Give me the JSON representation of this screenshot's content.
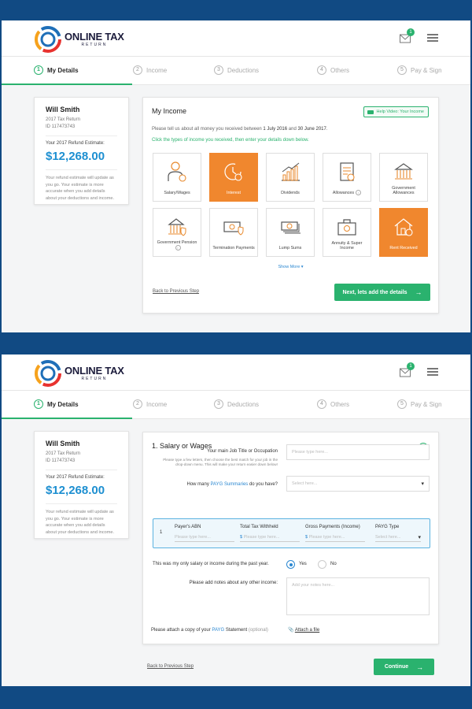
{
  "colors": {
    "accent": "#2ab26e",
    "brand_blue": "#1d8fd1",
    "selected_tile": "#f0872e",
    "background": "#114a83"
  },
  "brand": {
    "line1": "ONLINE TAX",
    "line2": "RETURN"
  },
  "header": {
    "notifications": "1",
    "icons": [
      "mail-icon",
      "menu-icon"
    ]
  },
  "steps": [
    {
      "num": "1",
      "label": "My Details"
    },
    {
      "num": "2",
      "label": "Income"
    },
    {
      "num": "3",
      "label": "Deductions"
    },
    {
      "num": "4",
      "label": "Others"
    },
    {
      "num": "5",
      "label": "Pay & Sign"
    }
  ],
  "user": {
    "name": "Will Smith",
    "return_year": "2017 Tax Return",
    "id": "ID 117473743",
    "estimate_label": "Your 2017 Refund Estimate:",
    "estimate": "$12,268.00",
    "note": "Your refund estimate will update as you go. Your estimate is more accurate when you add details about your deductions and income."
  },
  "income": {
    "title": "My Income",
    "help_button": "Help Video: Your Income",
    "intro_pre": "Please tell us about all money you received between ",
    "date_from": "1 July 2016",
    "intro_mid": " and ",
    "date_to": "30 June 2017",
    "intro_post": ".",
    "instruction": "Click the types of income you received, then enter your details down below.",
    "tiles": [
      {
        "label": "Salary/Wages",
        "icon": "person-dollar-icon",
        "selected": false
      },
      {
        "label": "Interest",
        "icon": "clock-dollar-icon",
        "selected": true
      },
      {
        "label": "Dividends",
        "icon": "bar-chart-icon",
        "selected": false
      },
      {
        "label": "Allowances",
        "icon": "document-dollar-icon",
        "selected": false
      },
      {
        "label": "Government Allowances",
        "icon": "government-building-icon",
        "selected": false
      },
      {
        "label": "Government Pension",
        "icon": "government-shield-icon",
        "selected": false
      },
      {
        "label": "Termination Payments",
        "icon": "cash-shield-icon",
        "selected": false
      },
      {
        "label": "Lump Sums",
        "icon": "cash-stack-icon",
        "selected": false
      },
      {
        "label": "Annuity & Super Income",
        "icon": "briefcase-dollar-icon",
        "selected": false
      },
      {
        "label": "Rent Received",
        "icon": "house-dollar-icon",
        "selected": true
      }
    ],
    "show_more": "Show More",
    "back": "Back to Previous Step",
    "next": "Next, lets add the details"
  },
  "salary": {
    "title": "1. Salary or Wages",
    "help": "?",
    "job_label": "Your main Job Title or Occupation",
    "job_placeholder": "Please type here...",
    "job_hint": "Please type a few letters, then choose the best match for your job in the drop-down menu. This will make your return easier down below!",
    "summaries_pre": "How many ",
    "summaries_link": "PAYG Summaries",
    "summaries_post": " do you have?",
    "summaries_placeholder": "Select here...",
    "row_num": "1",
    "columns": [
      "Payer's ABN",
      "Total Tax Withheld",
      "Gross Payments (Income)",
      "PAYG Type"
    ],
    "cells": [
      "Please type here...",
      "Please type here...",
      "Please type here...",
      "Select here..."
    ],
    "only_label": "This was my only salary or income during the past year.",
    "yes": "Yes",
    "no": "No",
    "only_value": "Yes",
    "notes_label": "Please add notes about any other income:",
    "notes_placeholder": "Add your notes here...",
    "attach_pre": "Please attach a copy of your ",
    "attach_link": "PAYG",
    "attach_mid": " Statement ",
    "attach_opt": "(optional)",
    "attach_button": "Attach a file",
    "back": "Back to Previous Step",
    "continue": "Continue"
  }
}
